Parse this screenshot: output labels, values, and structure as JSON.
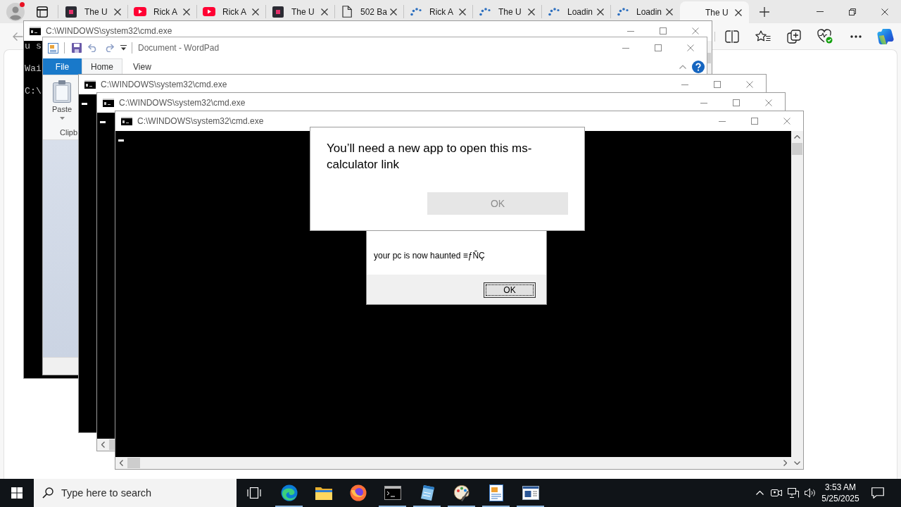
{
  "browser": {
    "tabs": [
      {
        "label": "The U",
        "kind": "site",
        "selected": false
      },
      {
        "label": "Rick A",
        "kind": "video",
        "selected": false
      },
      {
        "label": "Rick A",
        "kind": "video",
        "selected": false
      },
      {
        "label": "The U",
        "kind": "site",
        "selected": false
      },
      {
        "label": "502 Ba",
        "kind": "page",
        "selected": false
      },
      {
        "label": "Rick A",
        "kind": "loading",
        "selected": false
      },
      {
        "label": "The U",
        "kind": "loading",
        "selected": false
      },
      {
        "label": "Loadin",
        "kind": "loading",
        "selected": false
      },
      {
        "label": "Loadin",
        "kind": "loading",
        "selected": false
      },
      {
        "label": "The U",
        "kind": "none",
        "selected": true
      }
    ]
  },
  "windows": [
    {
      "kind": "console",
      "title": "C:\\WINDOWS\\system32\\cmd.exe",
      "lines": [
        "u s",
        "Wai",
        "C:\\"
      ],
      "cursor": false
    },
    {
      "kind": "wordpad",
      "title": "Document - WordPad",
      "tabs": [
        {
          "label": "File",
          "kind": "menu",
          "selected": false
        },
        {
          "label": "Home",
          "kind": "tab",
          "selected": true
        },
        {
          "label": "View",
          "kind": "tab",
          "selected": false
        }
      ],
      "ribbon": {
        "button": "Paste",
        "group": "Clipb"
      }
    },
    {
      "kind": "console",
      "title": "C:\\WINDOWS\\system32\\cmd.exe",
      "cursor": true
    },
    {
      "kind": "console",
      "title": "C:\\WINDOWS\\system32\\cmd.exe",
      "cursor": true
    },
    {
      "kind": "console",
      "title": "C:\\WINDOWS\\system32\\cmd.exe",
      "cursor": true
    }
  ],
  "dialogs": [
    {
      "kind": "app_prompt",
      "message": "You’ll need a new app to open this ms-calculator link",
      "button": {
        "label": "OK",
        "focused": false,
        "disabled": true
      }
    },
    {
      "kind": "message_box",
      "message": "your pc is now haunted ≡ƒÑÇ",
      "button": {
        "label": "OK",
        "focused": true,
        "disabled": false
      }
    }
  ],
  "taskbar": {
    "search": {
      "placeholder": "Type here to search"
    },
    "apps": [
      {
        "kind": "edge",
        "running": true
      },
      {
        "kind": "explorer",
        "running": false
      },
      {
        "kind": "firefox",
        "running": false
      },
      {
        "kind": "console",
        "running": true
      },
      {
        "kind": "notepad",
        "running": true
      },
      {
        "kind": "paint",
        "running": true
      },
      {
        "kind": "wordpad",
        "running": true
      },
      {
        "kind": "window",
        "running": true
      }
    ],
    "clock": {
      "time": "3:53 AM",
      "date": "5/25/2025"
    }
  }
}
